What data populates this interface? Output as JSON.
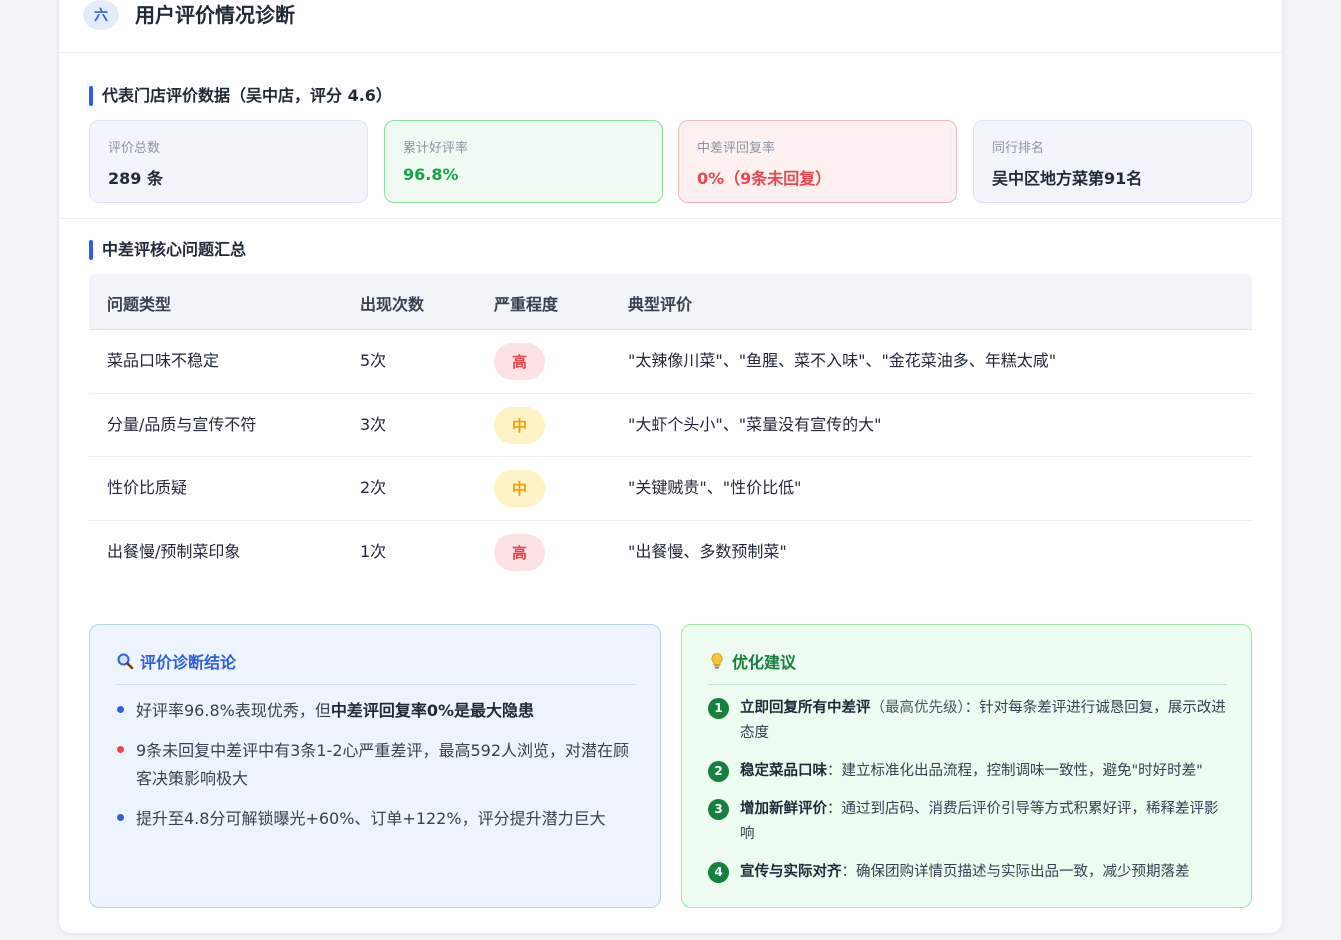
{
  "section": {
    "number": "六",
    "title": "用户评价情况诊断"
  },
  "store": {
    "title": "代表门店评价数据（吴中店，评分 4.6）",
    "metrics": [
      {
        "label": "评价总数",
        "value": "289 条"
      },
      {
        "label": "累计好评率",
        "value": "96.8%"
      },
      {
        "label": "中差评回复率",
        "value": "0%（9条未回复）"
      },
      {
        "label": "同行排名",
        "value": "吴中区地方菜第91名"
      }
    ]
  },
  "issues": {
    "title": "中差评核心问题汇总",
    "headers": [
      "问题类型",
      "出现次数",
      "严重程度",
      "典型评价"
    ],
    "rows": [
      {
        "type": "菜品口味不稳定",
        "count": "5次",
        "severity": "高",
        "quote": "\"太辣像川菜\"、\"鱼腥、菜不入味\"、\"金花菜油多、年糕太咸\""
      },
      {
        "type": "分量/品质与宣传不符",
        "count": "3次",
        "severity": "中",
        "quote": "\"大虾个头小\"、\"菜量没有宣传的大\""
      },
      {
        "type": "性价比质疑",
        "count": "2次",
        "severity": "中",
        "quote": "\"关键贼贵\"、\"性价比低\""
      },
      {
        "type": "出餐慢/预制菜印象",
        "count": "1次",
        "severity": "高",
        "quote": "\"出餐慢、多数预制菜\""
      }
    ]
  },
  "conclusion": {
    "title": "评价诊断结论",
    "icon": "magnifier-icon",
    "items": [
      {
        "pre": "好评率96.8%表现优秀，但",
        "bold": "中差评回复率0%是最大隐患",
        "post": ""
      },
      {
        "pre": "9条未回复中差评中有3条1-2心严重差评，最高592人浏览，对潜在顾客决策影响极大",
        "bold": "",
        "post": ""
      },
      {
        "pre": "提升至4.8分可解锁曝光+60%、订单+122%，评分提升潜力巨大",
        "bold": "",
        "post": ""
      }
    ]
  },
  "suggestions": {
    "title": "优化建议",
    "icon": "lightbulb-icon",
    "items": [
      {
        "num": "1",
        "bold": "立即回复所有中差评",
        "muted": "（最高优先级）",
        "text": "：针对每条差评进行诚恳回复，展示改进态度"
      },
      {
        "num": "2",
        "bold": "稳定菜品口味",
        "muted": "",
        "text": "：建立标准化出品流程，控制调味一致性，避免\"时好时差\""
      },
      {
        "num": "3",
        "bold": "增加新鲜评价",
        "muted": "",
        "text": "：通过到店码、消费后评价引导等方式积累好评，稀释差评影响"
      },
      {
        "num": "4",
        "bold": "宣传与实际对齐",
        "muted": "",
        "text": "：确保团购详情页描述与实际出品一致，减少预期落差"
      }
    ]
  },
  "colors": {
    "accent": "#2f5fe0",
    "good": "#16a34a",
    "bad": "#e5484d",
    "warn": "#f59e0b"
  }
}
